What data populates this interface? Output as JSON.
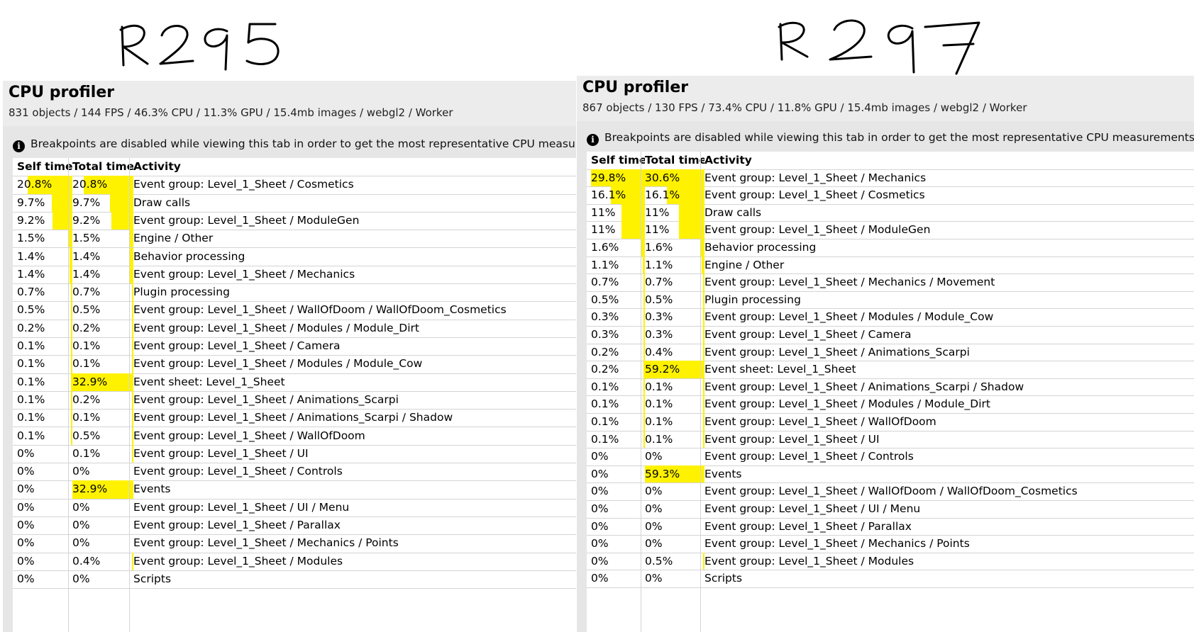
{
  "annotations": {
    "left_label": "R295",
    "right_label": "R297"
  },
  "colors": {
    "bar": "#fff200",
    "panel_bg": "#e6e6e6"
  },
  "panels": [
    {
      "title": "CPU profiler",
      "stats": "831 objects / 144 FPS / 46.3% CPU / 11.3% GPU / 15.4mb images / webgl2 / Worker",
      "notice": "Breakpoints are disabled while viewing this tab in order to get the most representative CPU measurements.",
      "info_icon": "info-icon",
      "columns": [
        "Self time",
        "Total time",
        "Activity"
      ],
      "rows": [
        {
          "self": "20.8%",
          "total": "20.8%",
          "activity": "Event group: Level_1_Sheet / Cosmetics",
          "self_pct": 20.8,
          "total_pct": 20.8
        },
        {
          "self": "9.7%",
          "total": "9.7%",
          "activity": "Draw calls",
          "self_pct": 9.7,
          "total_pct": 9.7
        },
        {
          "self": "9.2%",
          "total": "9.2%",
          "activity": "Event group: Level_1_Sheet / ModuleGen",
          "self_pct": 9.2,
          "total_pct": 9.2
        },
        {
          "self": "1.5%",
          "total": "1.5%",
          "activity": "Engine / Other",
          "self_pct": 1.5,
          "total_pct": 1.5
        },
        {
          "self": "1.4%",
          "total": "1.4%",
          "activity": "Behavior processing",
          "self_pct": 1.4,
          "total_pct": 1.4
        },
        {
          "self": "1.4%",
          "total": "1.4%",
          "activity": "Event group: Level_1_Sheet / Mechanics",
          "self_pct": 1.4,
          "total_pct": 1.4
        },
        {
          "self": "0.7%",
          "total": "0.7%",
          "activity": "Plugin processing",
          "self_pct": 0.7,
          "total_pct": 0.7
        },
        {
          "self": "0.5%",
          "total": "0.5%",
          "activity": "Event group: Level_1_Sheet / WallOfDoom / WallOfDoom_Cosmetics",
          "self_pct": 0.5,
          "total_pct": 0.5
        },
        {
          "self": "0.2%",
          "total": "0.2%",
          "activity": "Event group: Level_1_Sheet / Modules / Module_Dirt",
          "self_pct": 0.2,
          "total_pct": 0.2
        },
        {
          "self": "0.1%",
          "total": "0.1%",
          "activity": "Event group: Level_1_Sheet / Camera",
          "self_pct": 0.1,
          "total_pct": 0.1
        },
        {
          "self": "0.1%",
          "total": "0.1%",
          "activity": "Event group: Level_1_Sheet / Modules / Module_Cow",
          "self_pct": 0.1,
          "total_pct": 0.1
        },
        {
          "self": "0.1%",
          "total": "32.9%",
          "activity": "Event sheet: Level_1_Sheet",
          "self_pct": 0.1,
          "total_pct": 32.9
        },
        {
          "self": "0.1%",
          "total": "0.2%",
          "activity": "Event group: Level_1_Sheet / Animations_Scarpi",
          "self_pct": 0.1,
          "total_pct": 0.2
        },
        {
          "self": "0.1%",
          "total": "0.1%",
          "activity": "Event group: Level_1_Sheet / Animations_Scarpi / Shadow",
          "self_pct": 0.1,
          "total_pct": 0.1
        },
        {
          "self": "0.1%",
          "total": "0.5%",
          "activity": "Event group: Level_1_Sheet / WallOfDoom",
          "self_pct": 0.1,
          "total_pct": 0.5
        },
        {
          "self": "0%",
          "total": "0.1%",
          "activity": "Event group: Level_1_Sheet / UI",
          "self_pct": 0,
          "total_pct": 0.1
        },
        {
          "self": "0%",
          "total": "0%",
          "activity": "Event group: Level_1_Sheet / Controls",
          "self_pct": 0,
          "total_pct": 0
        },
        {
          "self": "0%",
          "total": "32.9%",
          "activity": "Events",
          "self_pct": 0,
          "total_pct": 32.9
        },
        {
          "self": "0%",
          "total": "0%",
          "activity": "Event group: Level_1_Sheet / UI / Menu",
          "self_pct": 0,
          "total_pct": 0
        },
        {
          "self": "0%",
          "total": "0%",
          "activity": "Event group: Level_1_Sheet / Parallax",
          "self_pct": 0,
          "total_pct": 0
        },
        {
          "self": "0%",
          "total": "0%",
          "activity": "Event group: Level_1_Sheet / Mechanics / Points",
          "self_pct": 0,
          "total_pct": 0
        },
        {
          "self": "0%",
          "total": "0.4%",
          "activity": "Event group: Level_1_Sheet / Modules",
          "self_pct": 0,
          "total_pct": 0.4
        },
        {
          "self": "0%",
          "total": "0%",
          "activity": "Scripts",
          "self_pct": 0,
          "total_pct": 0
        }
      ]
    },
    {
      "title": "CPU profiler",
      "stats": "867 objects / 130 FPS / 73.4% CPU / 11.8% GPU / 15.4mb images / webgl2 / Worker",
      "notice": "Breakpoints are disabled while viewing this tab in order to get the most representative CPU measurements.",
      "info_icon": "info-icon",
      "columns": [
        "Self time",
        "Total time",
        "Activity"
      ],
      "rows": [
        {
          "self": "29.8%",
          "total": "30.6%",
          "activity": "Event group: Level_1_Sheet / Mechanics",
          "self_pct": 29.8,
          "total_pct": 30.6
        },
        {
          "self": "16.1%",
          "total": "16.1%",
          "activity": "Event group: Level_1_Sheet / Cosmetics",
          "self_pct": 16.1,
          "total_pct": 16.1
        },
        {
          "self": "11%",
          "total": "11%",
          "activity": "Draw calls",
          "self_pct": 11,
          "total_pct": 11
        },
        {
          "self": "11%",
          "total": "11%",
          "activity": "Event group: Level_1_Sheet / ModuleGen",
          "self_pct": 11,
          "total_pct": 11
        },
        {
          "self": "1.6%",
          "total": "1.6%",
          "activity": "Behavior processing",
          "self_pct": 1.6,
          "total_pct": 1.6
        },
        {
          "self": "1.1%",
          "total": "1.1%",
          "activity": "Engine / Other",
          "self_pct": 1.1,
          "total_pct": 1.1
        },
        {
          "self": "0.7%",
          "total": "0.7%",
          "activity": "Event group: Level_1_Sheet / Mechanics / Movement",
          "self_pct": 0.7,
          "total_pct": 0.7
        },
        {
          "self": "0.5%",
          "total": "0.5%",
          "activity": "Plugin processing",
          "self_pct": 0.5,
          "total_pct": 0.5
        },
        {
          "self": "0.3%",
          "total": "0.3%",
          "activity": "Event group: Level_1_Sheet / Modules / Module_Cow",
          "self_pct": 0.3,
          "total_pct": 0.3
        },
        {
          "self": "0.3%",
          "total": "0.3%",
          "activity": "Event group: Level_1_Sheet / Camera",
          "self_pct": 0.3,
          "total_pct": 0.3
        },
        {
          "self": "0.2%",
          "total": "0.4%",
          "activity": "Event group: Level_1_Sheet / Animations_Scarpi",
          "self_pct": 0.2,
          "total_pct": 0.4
        },
        {
          "self": "0.2%",
          "total": "59.2%",
          "activity": "Event sheet: Level_1_Sheet",
          "self_pct": 0.2,
          "total_pct": 59.2
        },
        {
          "self": "0.1%",
          "total": "0.1%",
          "activity": "Event group: Level_1_Sheet / Animations_Scarpi / Shadow",
          "self_pct": 0.1,
          "total_pct": 0.1
        },
        {
          "self": "0.1%",
          "total": "0.1%",
          "activity": "Event group: Level_1_Sheet / Modules / Module_Dirt",
          "self_pct": 0.1,
          "total_pct": 0.1
        },
        {
          "self": "0.1%",
          "total": "0.1%",
          "activity": "Event group: Level_1_Sheet / WallOfDoom",
          "self_pct": 0.1,
          "total_pct": 0.1
        },
        {
          "self": "0.1%",
          "total": "0.1%",
          "activity": "Event group: Level_1_Sheet / UI",
          "self_pct": 0.1,
          "total_pct": 0.1
        },
        {
          "self": "0%",
          "total": "0%",
          "activity": "Event group: Level_1_Sheet / Controls",
          "self_pct": 0,
          "total_pct": 0
        },
        {
          "self": "0%",
          "total": "59.3%",
          "activity": "Events",
          "self_pct": 0,
          "total_pct": 59.3
        },
        {
          "self": "0%",
          "total": "0%",
          "activity": "Event group: Level_1_Sheet / WallOfDoom / WallOfDoom_Cosmetics",
          "self_pct": 0,
          "total_pct": 0
        },
        {
          "self": "0%",
          "total": "0%",
          "activity": "Event group: Level_1_Sheet / UI / Menu",
          "self_pct": 0,
          "total_pct": 0
        },
        {
          "self": "0%",
          "total": "0%",
          "activity": "Event group: Level_1_Sheet / Parallax",
          "self_pct": 0,
          "total_pct": 0
        },
        {
          "self": "0%",
          "total": "0%",
          "activity": "Event group: Level_1_Sheet / Mechanics / Points",
          "self_pct": 0,
          "total_pct": 0
        },
        {
          "self": "0%",
          "total": "0.5%",
          "activity": "Event group: Level_1_Sheet / Modules",
          "self_pct": 0,
          "total_pct": 0.5
        },
        {
          "self": "0%",
          "total": "0%",
          "activity": "Scripts",
          "self_pct": 0,
          "total_pct": 0
        }
      ]
    }
  ]
}
